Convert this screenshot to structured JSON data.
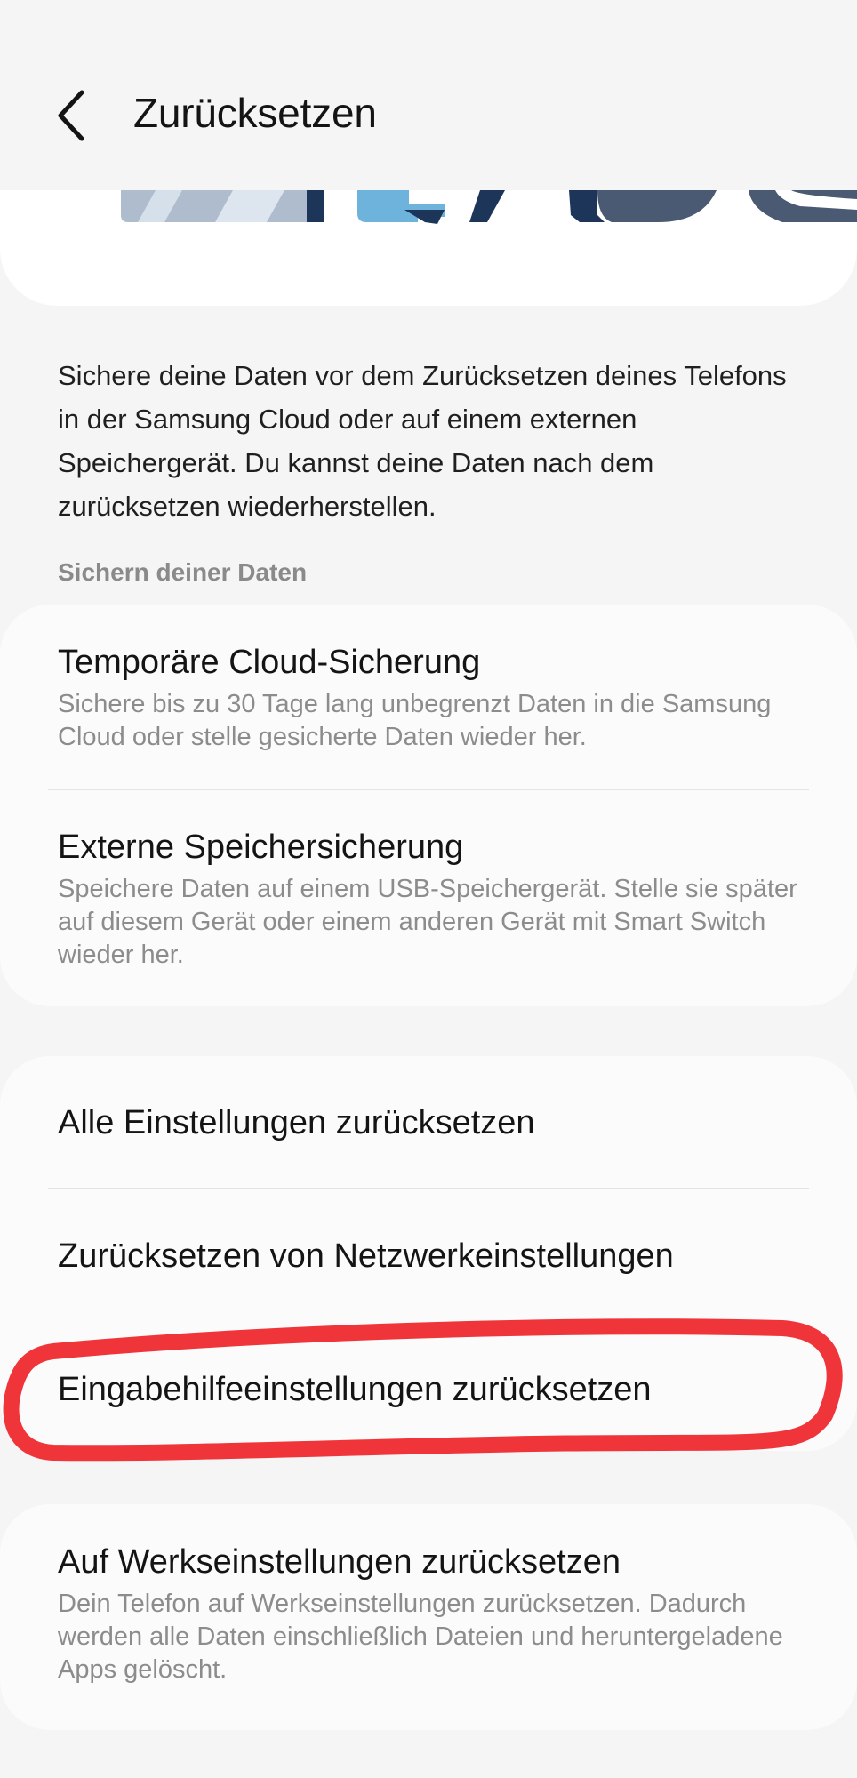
{
  "header": {
    "title": "Zurücksetzen"
  },
  "description": "Sichere deine Daten vor dem Zurücksetzen deines Telefons in der Samsung Cloud oder auf einem externen Speichergerät. Du kannst deine Daten nach dem zurücksetzen wiederherstellen.",
  "section_label": "Sichern deiner Daten",
  "backup_items": [
    {
      "title": "Temporäre Cloud-Sicherung",
      "subtitle": "Sichere bis zu 30 Tage lang unbegrenzt Daten in die Samsung Cloud oder stelle gesicherte Daten wieder her."
    },
    {
      "title": "Externe Speichersicherung",
      "subtitle": "Speichere Daten auf einem USB-Speichergerät. Stelle sie später auf diesem Gerät oder einem anderen Gerät mit Smart Switch wieder her."
    }
  ],
  "reset_items": [
    {
      "title": "Alle Einstellungen zurücksetzen"
    },
    {
      "title": "Zurücksetzen von Netzwerkeinstellungen"
    },
    {
      "title": "Eingabehilfeeinstellungen zurücksetzen"
    }
  ],
  "factory_reset": {
    "title": "Auf Werkseinstellungen zurücksetzen",
    "subtitle": "Dein Telefon auf Werkseinstellungen zurücksetzen. Dadurch werden alle Daten einschließlich Dateien und heruntergeladene Apps gelöscht."
  },
  "icons": {
    "back": "chevron-left-icon"
  },
  "colors": {
    "background": "#f5f5f5",
    "card": "#fbfbfb",
    "highlight_annotation": "#f0353a",
    "secondary_text": "#8c8c8c"
  }
}
